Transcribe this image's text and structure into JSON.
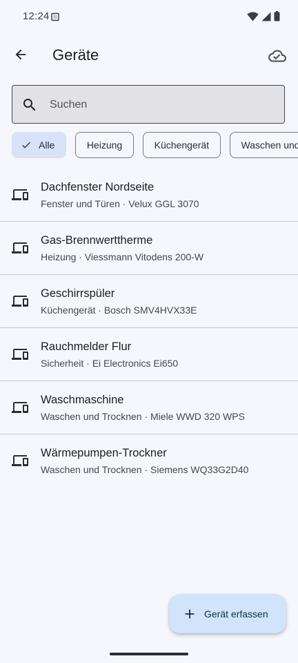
{
  "status_bar": {
    "time": "12:24",
    "icons": [
      "screenshot-icon",
      "wifi-icon",
      "signal-icon",
      "battery-icon"
    ]
  },
  "app_bar": {
    "title": "Geräte",
    "back_icon": "arrow-back-icon",
    "sync_icon": "cloud-done-icon"
  },
  "search": {
    "value": "",
    "placeholder": "Suchen",
    "icon": "search-icon"
  },
  "filters": [
    {
      "label": "Alle",
      "selected": true
    },
    {
      "label": "Heizung",
      "selected": false
    },
    {
      "label": "Küchengerät",
      "selected": false
    },
    {
      "label": "Waschen und Trocknen",
      "selected": false
    }
  ],
  "devices": [
    {
      "name": "Dachfenster Nordseite",
      "details": "Fenster und Türen · Velux GGL 3070",
      "icon": "devices-icon"
    },
    {
      "name": "Gas-Brennwerttherme",
      "details": "Heizung · Viessmann Vitodens 200-W",
      "icon": "devices-icon"
    },
    {
      "name": "Geschirrspüler",
      "details": "Küchengerät · Bosch SMV4HVX33E",
      "icon": "devices-icon"
    },
    {
      "name": "Rauchmelder Flur",
      "details": "Sicherheit · Ei Electronics Ei650",
      "icon": "devices-icon"
    },
    {
      "name": "Waschmaschine",
      "details": "Waschen und Trocknen · Miele WWD 320 WPS",
      "icon": "devices-icon"
    },
    {
      "name": "Wärmepumpen-Trockner",
      "details": "Waschen und Trocknen · Siemens WQ33G2D40",
      "icon": "devices-icon"
    }
  ],
  "fab": {
    "label": "Gerät erfassen",
    "icon": "add-icon"
  },
  "colors": {
    "background": "#f6f7fc",
    "selected_chip": "#d8e3f8",
    "fab": "#d2e4fb"
  }
}
